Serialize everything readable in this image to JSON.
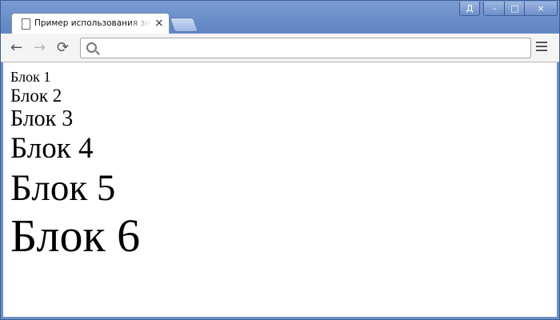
{
  "browser": {
    "tab_title": "Пример использования значения",
    "close_glyph": "×",
    "window_controls": {
      "user": "Д",
      "minimize": "–",
      "maximize": "□",
      "close": "×"
    },
    "toolbar": {
      "back": "←",
      "forward": "→",
      "reload": "⟳",
      "address_value": ""
    }
  },
  "page": {
    "blocks": [
      "Блок 1",
      "Блок 2",
      "Блок 3",
      "Блок 4",
      "Блок 5",
      "Блок 6"
    ]
  }
}
